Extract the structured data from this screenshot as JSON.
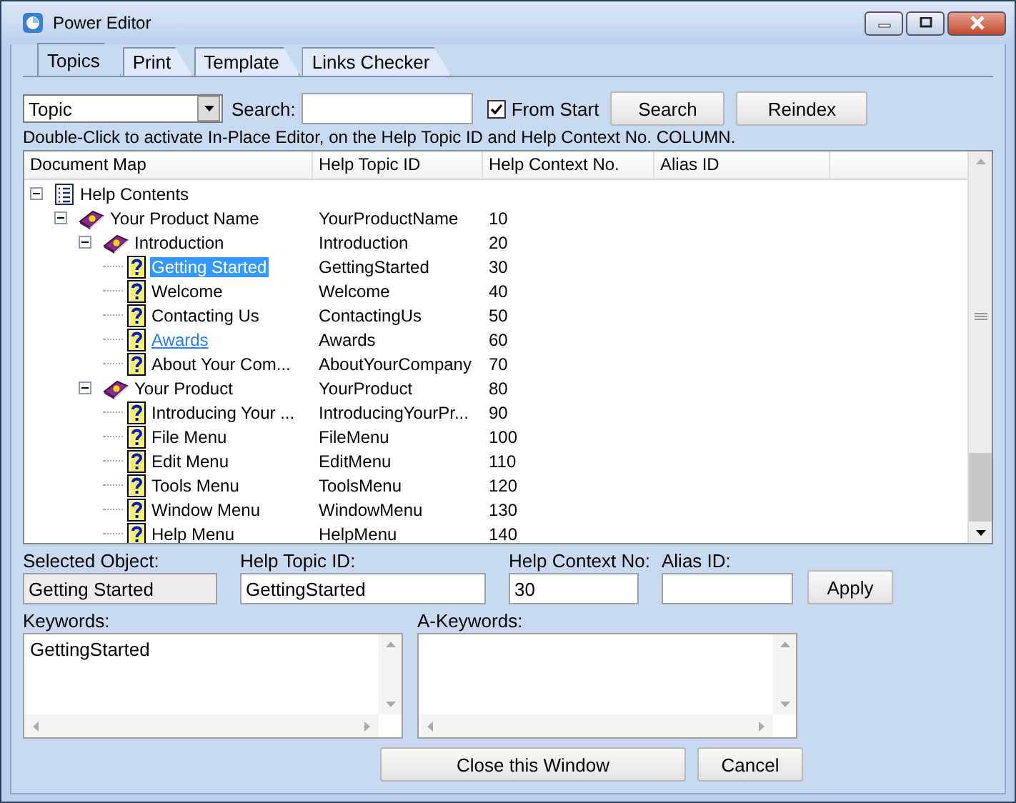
{
  "window": {
    "title": "Power Editor"
  },
  "tabs": [
    {
      "label": "Topics",
      "selected": true
    },
    {
      "label": "Print",
      "selected": false
    },
    {
      "label": "Template",
      "selected": false
    },
    {
      "label": "Links Checker",
      "selected": false
    }
  ],
  "toolbar": {
    "field_type": "Topic",
    "search_label": "Search:",
    "from_start": {
      "label": "From Start",
      "checked": true
    },
    "buttons": [
      "Search",
      "Reindex"
    ]
  },
  "hint": "Double-Click to activate In-Place Editor, on the Help Topic ID and Help Context No. COLUMN.",
  "tree": {
    "columns": [
      "Document Map",
      "Help Topic ID",
      "Help Context No.",
      "Alias ID"
    ],
    "rows": [
      {
        "kind": "contents",
        "label": "Help Contents",
        "expanded": true,
        "selected": false,
        "hover": false,
        "children": [
          {
            "kind": "book",
            "label": "Your Product Name",
            "topic_id": "YourProductName",
            "context_no": "10",
            "expanded": true,
            "selected": false,
            "hover": false,
            "children": [
              {
                "kind": "book",
                "label": "Introduction",
                "topic_id": "Introduction",
                "context_no": "20",
                "expanded": true,
                "selected": false,
                "hover": false,
                "children": [
                  {
                    "kind": "topic",
                    "label": "Getting Started",
                    "topic_id": "GettingStarted",
                    "context_no": "30",
                    "selected": true,
                    "hover": false
                  },
                  {
                    "kind": "topic",
                    "label": "Welcome",
                    "topic_id": "Welcome",
                    "context_no": "40",
                    "selected": false,
                    "hover": false
                  },
                  {
                    "kind": "topic",
                    "label": "Contacting Us",
                    "topic_id": "ContactingUs",
                    "context_no": "50",
                    "selected": false,
                    "hover": false
                  },
                  {
                    "kind": "topic",
                    "label": "Awards",
                    "topic_id": "Awards",
                    "context_no": "60",
                    "selected": false,
                    "hover": true
                  },
                  {
                    "kind": "topic",
                    "label": "About Your Com...",
                    "topic_id": "AboutYourCompany",
                    "context_no": "70",
                    "selected": false,
                    "hover": false
                  }
                ]
              },
              {
                "kind": "book",
                "label": "Your Product",
                "topic_id": "YourProduct",
                "context_no": "80",
                "expanded": true,
                "selected": false,
                "hover": false,
                "children": [
                  {
                    "kind": "topic",
                    "label": "Introducing Your ...",
                    "topic_id": "IntroducingYourPr...",
                    "context_no": "90",
                    "selected": false,
                    "hover": false
                  },
                  {
                    "kind": "topic",
                    "label": "File Menu",
                    "topic_id": "FileMenu",
                    "context_no": "100",
                    "selected": false,
                    "hover": false
                  },
                  {
                    "kind": "topic",
                    "label": "Edit Menu",
                    "topic_id": "EditMenu",
                    "context_no": "110",
                    "selected": false,
                    "hover": false
                  },
                  {
                    "kind": "topic",
                    "label": "Tools Menu",
                    "topic_id": "ToolsMenu",
                    "context_no": "120",
                    "selected": false,
                    "hover": false
                  },
                  {
                    "kind": "topic",
                    "label": "Window Menu",
                    "topic_id": "WindowMenu",
                    "context_no": "130",
                    "selected": false,
                    "hover": false
                  },
                  {
                    "kind": "topic",
                    "label": "Help Menu",
                    "topic_id": "HelpMenu",
                    "context_no": "140",
                    "selected": false,
                    "hover": false
                  }
                ]
              }
            ]
          }
        ]
      }
    ]
  },
  "details": [
    {
      "label": "Selected Object:",
      "value": "Getting Started",
      "disabled": true
    },
    {
      "label": "Help Topic ID:",
      "value": "GettingStarted",
      "disabled": false
    },
    {
      "label": "Help Context No:",
      "value": "30",
      "disabled": false
    },
    {
      "label": "Alias ID:",
      "disabled": false
    }
  ],
  "apply_button": "Apply",
  "keywords": [
    {
      "label": "Keywords:",
      "value": "GettingStarted"
    },
    {
      "label": "A-Keywords:"
    }
  ],
  "footer_buttons": [
    "Close this Window",
    "Cancel"
  ]
}
